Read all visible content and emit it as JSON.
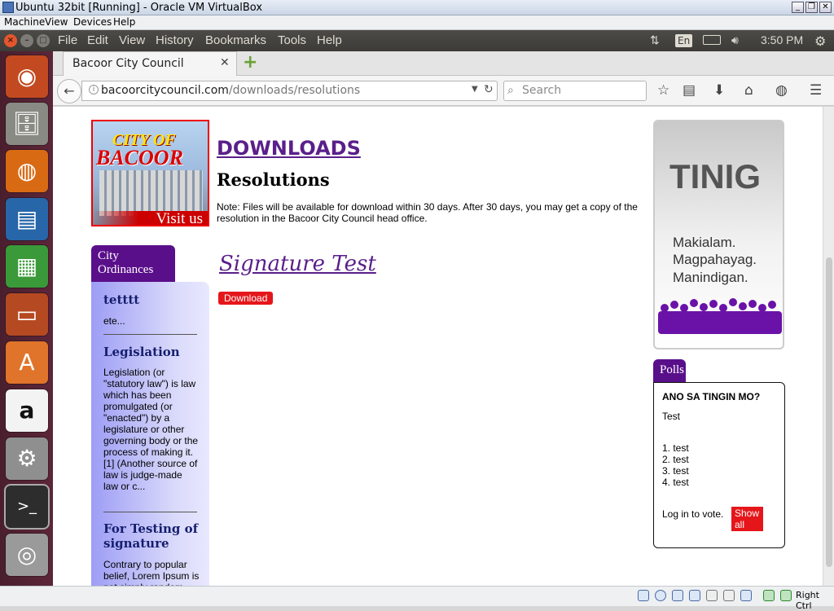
{
  "vbox": {
    "title": "Ubuntu 32bit [Running] - Oracle VM VirtualBox",
    "menu": [
      "Machine",
      "View",
      "Devices",
      "Help"
    ],
    "host_key": "Right Ctrl"
  },
  "panel": {
    "menu": [
      "File",
      "Edit",
      "View",
      "History",
      "Bookmarks",
      "Tools",
      "Help"
    ],
    "keyboard": "En",
    "clock": "3:50 PM"
  },
  "launcher": [
    "ubuntu-dash",
    "files",
    "firefox",
    "writer",
    "calc",
    "impress",
    "software-center",
    "amazon",
    "system-settings",
    "terminal",
    "dvd"
  ],
  "browser": {
    "tab_title": "Bacoor City Council",
    "url_host": "bacoorcitycouncil.com",
    "url_path": "/downloads/resolutions",
    "search_placeholder": "Search"
  },
  "page": {
    "logo": {
      "line1": "CITY OF",
      "line2": "BACOOR",
      "visit": "Visit us"
    },
    "heading": "DOWNLOADS",
    "subheading": "Resolutions",
    "note": "Note: Files will be available for download within 30 days. After 30 days, you may get a copy of the resolution in the Bacoor City Council head office.",
    "item_title": "Signature Test",
    "download_label": "Download",
    "ordinances": {
      "tab": "City Ordinances",
      "items": [
        {
          "title": "tetttt",
          "body": "ete..."
        },
        {
          "title": "Legislation",
          "body": "Legislation (or \"statutory law\") is law which has been promulgated (or \"enacted\") by a legislature or other governing body or the process of making it.[1] (Another source of law is judge-made law or c..."
        },
        {
          "title": "For Testing of signature",
          "body": "Contrary to popular belief, Lorem Ipsum is not simply random"
        }
      ]
    },
    "tinig": {
      "title": "TINIG",
      "lines": [
        "Makialam.",
        "Magpahayag.",
        "Manindigan."
      ]
    },
    "polls": {
      "tab": "Polls",
      "question": "ANO SA TINGIN MO?",
      "description": "Test",
      "options": [
        "1. test",
        "2. test",
        "3. test",
        "4. test"
      ],
      "login_text": "Log in to vote.",
      "show_all": "Show all"
    }
  },
  "colors": {
    "accent_purple": "#5a0f8a",
    "button_red": "#e5161a",
    "link_purple": "#5a1f8a"
  }
}
